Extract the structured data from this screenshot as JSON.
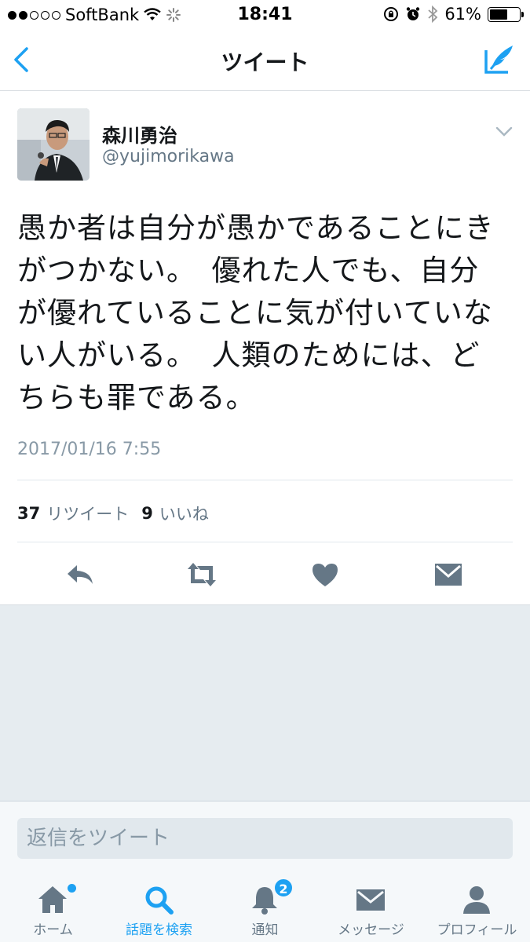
{
  "status_bar": {
    "carrier": "SoftBank",
    "time": "18:41",
    "battery": "61%",
    "battery_level": 0.61
  },
  "nav": {
    "title": "ツイート"
  },
  "tweet": {
    "author_name": "森川勇治",
    "author_handle": "@yujimorikawa",
    "text_lines": [
      "愚か者は自分が愚かであることにき",
      "がつかない。　優れた人でも、自分",
      "が優れていることに気が付いていな",
      "い人がいる。　人類のためには、ど",
      "ちらも罪である。"
    ],
    "timestamp": "2017/01/16 7:55",
    "retweet_count": "37",
    "retweet_label": "リツイート",
    "like_count": "9",
    "like_label": "いいね"
  },
  "reply": {
    "placeholder": "返信をツイート"
  },
  "tabs": [
    {
      "label": "ホーム",
      "icon": "home-icon"
    },
    {
      "label": "話題を検索",
      "icon": "search-icon",
      "active": true
    },
    {
      "label": "通知",
      "icon": "bell-icon",
      "badge": "2"
    },
    {
      "label": "メッセージ",
      "icon": "envelope-icon"
    },
    {
      "label": "プロフィール",
      "icon": "person-icon"
    }
  ],
  "colors": {
    "accent": "#1da1f2",
    "icon_gray": "#657786",
    "background_gray": "#e6ecf0"
  }
}
